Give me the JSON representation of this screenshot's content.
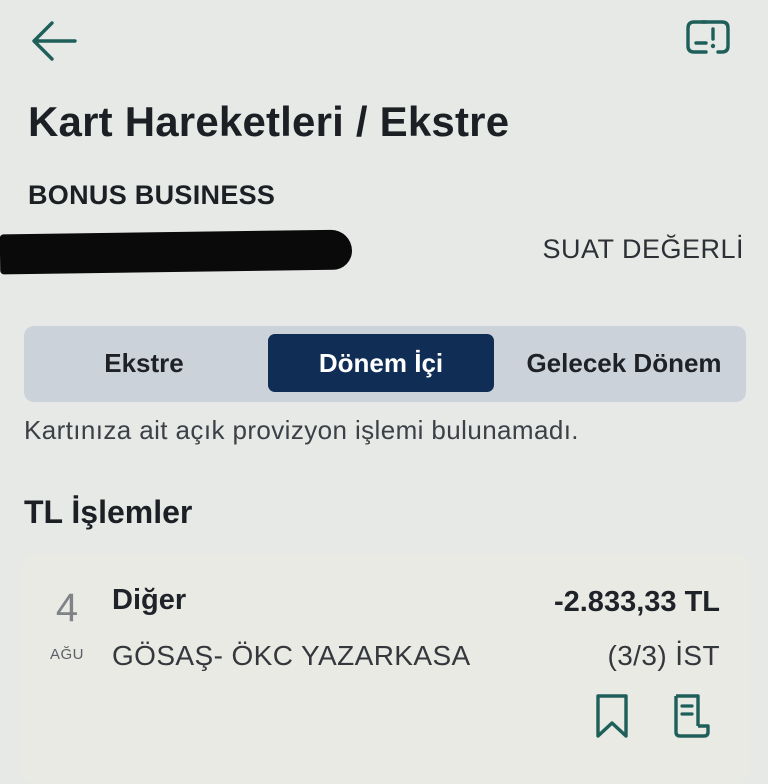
{
  "header": {
    "back_icon": "arrow-left-icon",
    "report_icon": "report-issue-icon",
    "title": "Kart Hareketleri / Ekstre"
  },
  "card": {
    "name": "BONUS BUSINESS",
    "number_redacted": true,
    "holder": "SUAT DEĞERLİ"
  },
  "tabs": [
    {
      "label": "Ekstre",
      "selected": false
    },
    {
      "label": "Dönem İçi",
      "selected": true
    },
    {
      "label": "Gelecek Dönem",
      "selected": false
    }
  ],
  "info_message": "Kartınıza ait açık provizyon işlemi bulunamadı.",
  "section": {
    "title": "TL İşlemler"
  },
  "transactions": [
    {
      "day": "4",
      "month": "AĞU",
      "category": "Diğer",
      "amount": "-2.833,33 TL",
      "merchant": "GÖSAŞ- ÖKC YAZARKASA",
      "installment": "(3/3) İST",
      "actions": [
        "bookmark-icon",
        "receipt-icon"
      ]
    }
  ],
  "colors": {
    "background": "#e6e9e6",
    "accent": "#0f2d55",
    "icon": "#1f5f5a",
    "segment_bg": "#ccd2d9",
    "card_bg": "#e9eae4"
  }
}
